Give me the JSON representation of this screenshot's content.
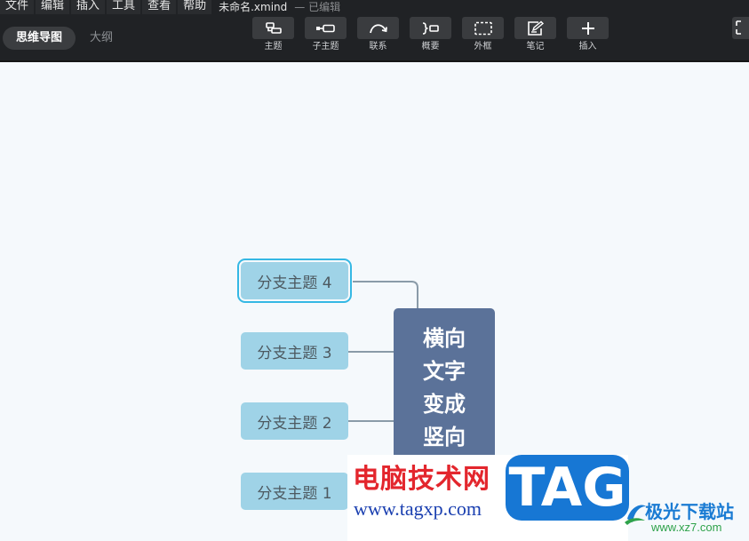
{
  "menu": {
    "items": [
      {
        "label": "文件"
      },
      {
        "label": "编辑"
      },
      {
        "label": "插入"
      },
      {
        "label": "工具"
      },
      {
        "label": "查看"
      },
      {
        "label": "帮助"
      }
    ]
  },
  "document": {
    "title": "未命名.xmind",
    "status": "— 已编辑"
  },
  "view_switch": {
    "active": "思维导图",
    "other": "大纲"
  },
  "toolbar": {
    "topic": "主题",
    "subtopic": "子主题",
    "relationship": "联系",
    "summary": "概要",
    "boundary": "外框",
    "note": "笔记",
    "insert": "插入"
  },
  "mindmap": {
    "central": {
      "lines": [
        "横向",
        "文字",
        "变成",
        "竖向"
      ]
    },
    "branches": [
      {
        "label": "分支主题 4",
        "selected": true
      },
      {
        "label": "分支主题 3",
        "selected": false
      },
      {
        "label": "分支主题 2",
        "selected": false
      },
      {
        "label": "分支主题 1",
        "selected": false
      }
    ],
    "colors": {
      "central": "#5b7299",
      "branch": "#9fd3e7",
      "selection": "#35b8e4",
      "connector": "#8a9ba8"
    }
  },
  "watermark": {
    "site_name": "电脑技术网",
    "site_url": "www.tagxp.com",
    "tag": "TAG",
    "brand_name": "极光下载站",
    "brand_url": "www.xz7.com"
  }
}
